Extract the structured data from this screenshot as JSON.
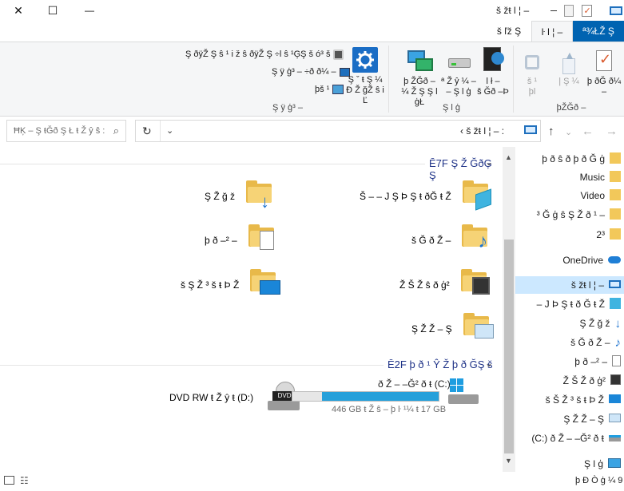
{
  "titlebar": {
    "title": "š žŧ l ¦ –",
    "close": "✕",
    "maximize": "☐",
    "minimize": "—"
  },
  "tabs": [
    {
      "label": "š ľž Ş"
    },
    {
      "label": "ŀ l ¦ –"
    },
    {
      "label": "ª¾ŁŽ Ş"
    }
  ],
  "ribbon": {
    "network_group": {
      "label": "Ş ÿ ģ³ –",
      "small": [
        "Ş ðÿŽ Ş ŝ ¹ i   ž   ŝ ðÿŽ Ş ÷l   ŝ ¹ĢŞ š  ó³ š",
        "Ş ÿ ģ³  – ÷ð ð¼  –",
        "þš ¹"
      ],
      "settings": "Ş ˇ ŧ Ş ¼\nĐ Ž ğŽ ŝ i Ľ"
    },
    "location_group": {
      "label": "Ş l  ģ",
      "items": [
        "þ ŽĞð – ¼ Ž Ş Ş l  ģŁ",
        "ª Ž ŷ ¼  –\n– Ş l  ģ",
        "l  ł –\nš Ğð –Þ"
      ]
    },
    "system_group": {
      "label": "þŽĞð –",
      "items": [
        "š ¹\nþl",
        "| Ş ¼",
        "þ ðĞ ð¼  –"
      ]
    }
  },
  "address": {
    "search_placeholder": "ĦĶ – Ş ŧĞð Ş Ł ŧ  Ž ŷ ŝ  :",
    "path": "‹  š žŧ l ¦ – :"
  },
  "main": {
    "folders_header": "Ē7F Ş Ž ĞðĢ Ş",
    "drives_header": "Ē2F þ ð ¹ Ŷ Ž þ ð ĞŞ š",
    "folders": [
      {
        "name": "Ş Ž ğ ž"
      },
      {
        "name": "Š – – J Ş Þ Ş ŧ ðĞ ŧ Ž"
      },
      {
        "name": "þ ð –² –"
      },
      {
        "name": "š Ğ ð  Ž –"
      },
      {
        "name": "š Ş Ž ³ š ŧ Þ Ž"
      },
      {
        "name": "Ž Š Ž ŝ ð ģ²"
      },
      {
        "name": "Ş Ž Ž – Ş"
      }
    ],
    "drives": [
      {
        "name": "DVD RW ŧ Ž ŷ ŧ (D:)"
      },
      {
        "name": "ð Ž – –Ğ² ð ŧ (C:)",
        "free": "446 GB ŧ Ž ŝ – þ ŀ ¹¼ ŧ 17 GB",
        "used_fraction": 0.2
      }
    ]
  },
  "navpane": {
    "items": [
      {
        "label": "þ ð ŝ ð þ ð Ğ ģ",
        "type": "pin"
      },
      {
        "label": "Music",
        "type": "folder"
      },
      {
        "label": "Video",
        "type": "folder"
      },
      {
        "label": "³ Ğ ģ ŝ Ş Ž ð ¹ –",
        "type": "folder"
      },
      {
        "label": "2³",
        "type": "folder"
      },
      {
        "label": "OneDrive",
        "type": "cloud"
      },
      {
        "label": "š žŧ l ¦ –",
        "type": "pc"
      },
      {
        "label": "– J Þ Ş ŧ ð Ğ ŧ Ž",
        "type": "3d"
      },
      {
        "label": "Ş Ž ğ ž",
        "type": "download"
      },
      {
        "label": "š Ğ ð  Ž –",
        "type": "music"
      },
      {
        "label": "þ ð –² –",
        "type": "doc"
      },
      {
        "label": "Ž Š Ž ð ģ²",
        "type": "video"
      },
      {
        "label": "š Š Ž ³ š ŧ Þ Ž",
        "type": "desktop"
      },
      {
        "label": "Ş Ž Ž – Ş",
        "type": "pictures"
      },
      {
        "label": "(C:) ð Ž – –Ğ² ð ŧ",
        "type": "drive"
      },
      {
        "label": "Ş l  ģ",
        "type": "network"
      }
    ]
  },
  "status": {
    "count": "þ Ð Ò ģ ¼ 9"
  }
}
